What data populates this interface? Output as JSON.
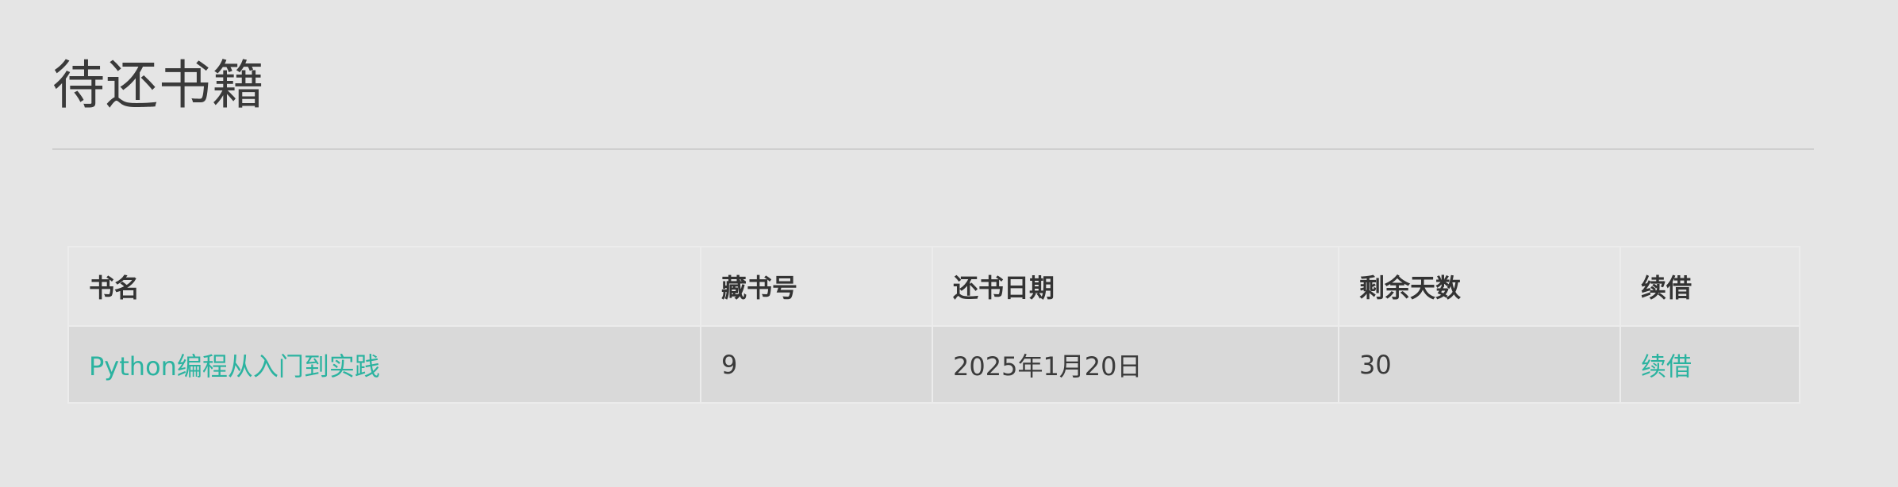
{
  "page": {
    "title": "待还书籍"
  },
  "table": {
    "headers": {
      "book_name": "书名",
      "call_number": "藏书号",
      "due_date": "还书日期",
      "days_left": "剩余天数",
      "renew": "续借"
    },
    "rows": [
      {
        "book_name": "Python编程从入门到实践",
        "call_number": "9",
        "due_date": "2025年1月20日",
        "days_left": "30",
        "renew": "续借"
      }
    ]
  },
  "colors": {
    "background": "#e5e5e5",
    "row_background": "#d9d9d9",
    "link": "#2bb3a0",
    "text": "#333333"
  }
}
